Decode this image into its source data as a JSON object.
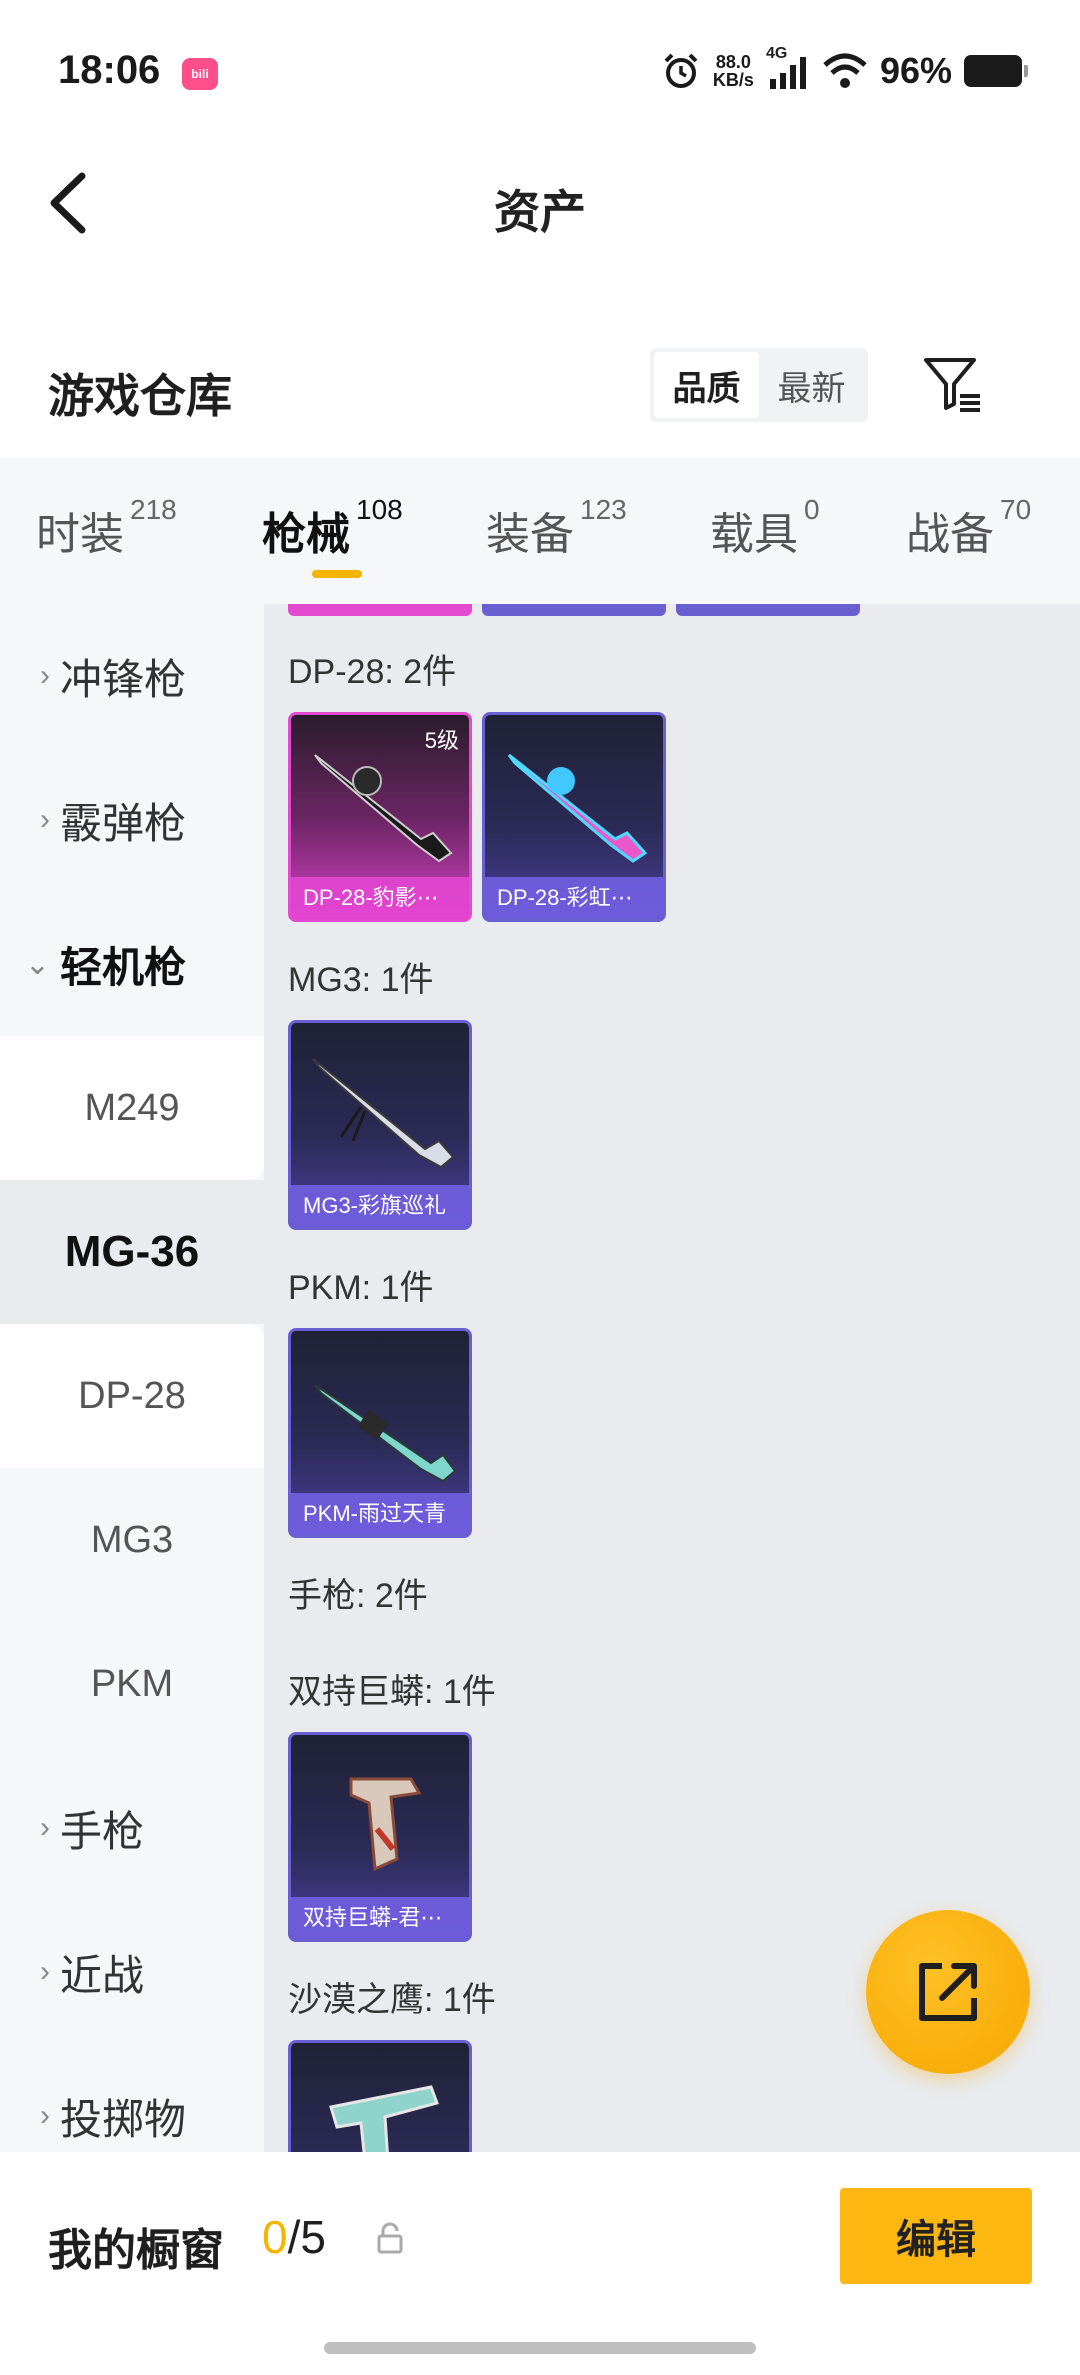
{
  "status_bar": {
    "time": "18:06",
    "app_badge": "bili",
    "speed_top": "88.0",
    "speed_bottom": "KB/s",
    "network": "4G",
    "battery": "96%"
  },
  "header": {
    "title": "资产"
  },
  "section": {
    "title": "游戏仓库"
  },
  "sort": {
    "options": [
      "品质",
      "最新"
    ],
    "active": "品质"
  },
  "tabs": [
    {
      "label": "时装",
      "count": "218"
    },
    {
      "label": "枪械",
      "count": "108"
    },
    {
      "label": "装备",
      "count": "123"
    },
    {
      "label": "载具",
      "count": "0"
    },
    {
      "label": "战备",
      "count": "70"
    }
  ],
  "active_tab": "枪械",
  "sidebar": {
    "categories": [
      "冲锋枪",
      "霰弹枪",
      "轻机枪",
      "手枪",
      "近战",
      "投掷物"
    ],
    "open_category": "轻机枪",
    "subitems": [
      "M249",
      "MG-36",
      "DP-28",
      "MG3",
      "PKM"
    ],
    "active_subitem": "MG-36"
  },
  "groups": [
    {
      "title": "DP-28: 2件",
      "items": [
        {
          "name": "DP-28-豹影⋯",
          "level": "5级",
          "quality": "legend"
        },
        {
          "name": "DP-28-彩虹⋯",
          "level": "",
          "quality": "epic"
        }
      ]
    },
    {
      "title": "MG3: 1件",
      "items": [
        {
          "name": "MG3-彩旗巡礼",
          "level": "",
          "quality": "epic"
        }
      ]
    },
    {
      "title": "PKM: 1件",
      "items": [
        {
          "name": "PKM-雨过天青",
          "level": "",
          "quality": "epic"
        }
      ]
    },
    {
      "title": "手枪: 2件",
      "items": []
    },
    {
      "title": "双持巨蟒: 1件",
      "items": [
        {
          "name": "双持巨蟒-君⋯",
          "level": "",
          "quality": "epic"
        }
      ]
    },
    {
      "title": "沙漠之鹰: 1件",
      "items": [
        {
          "name": "",
          "level": "",
          "quality": "epic"
        }
      ]
    }
  ],
  "bottom": {
    "label": "我的橱窗",
    "current": "0",
    "separator": "/",
    "total": "5",
    "edit_label": "编辑"
  },
  "colors": {
    "accent": "#f5b400",
    "legend": "#e24bd0",
    "epic": "#6a5fd0"
  }
}
